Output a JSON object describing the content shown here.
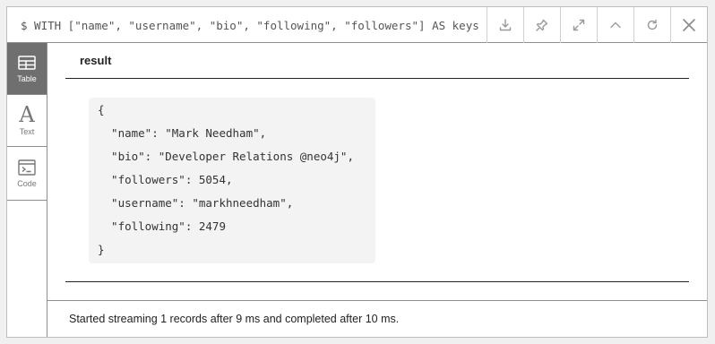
{
  "query": "$ WITH [\"name\", \"username\", \"bio\", \"following\", \"followers\"] AS keys",
  "toolbar": {
    "icons": [
      "download-icon",
      "pin-icon",
      "expand-icon",
      "collapse-icon",
      "rerun-icon",
      "close-icon"
    ]
  },
  "sidebar": {
    "items": [
      {
        "label": "Table",
        "icon": "table-icon",
        "active": true
      },
      {
        "label": "Text",
        "icon": "text-icon",
        "active": false
      },
      {
        "label": "Code",
        "icon": "code-icon",
        "active": false
      }
    ]
  },
  "table": {
    "column": "result",
    "lines": [
      "{",
      "  \"name\": \"Mark Needham\",",
      "  \"bio\": \"Developer Relations @neo4j\",",
      "  \"followers\": 5054,",
      "  \"username\": \"markhneedham\",",
      "  \"following\": 2479",
      "}"
    ]
  },
  "status": "Started streaming 1 records after 9 ms and completed after 10 ms.",
  "colors": {
    "active_tab": "#6f6f6f",
    "cell_bg": "#f3f3f3"
  }
}
